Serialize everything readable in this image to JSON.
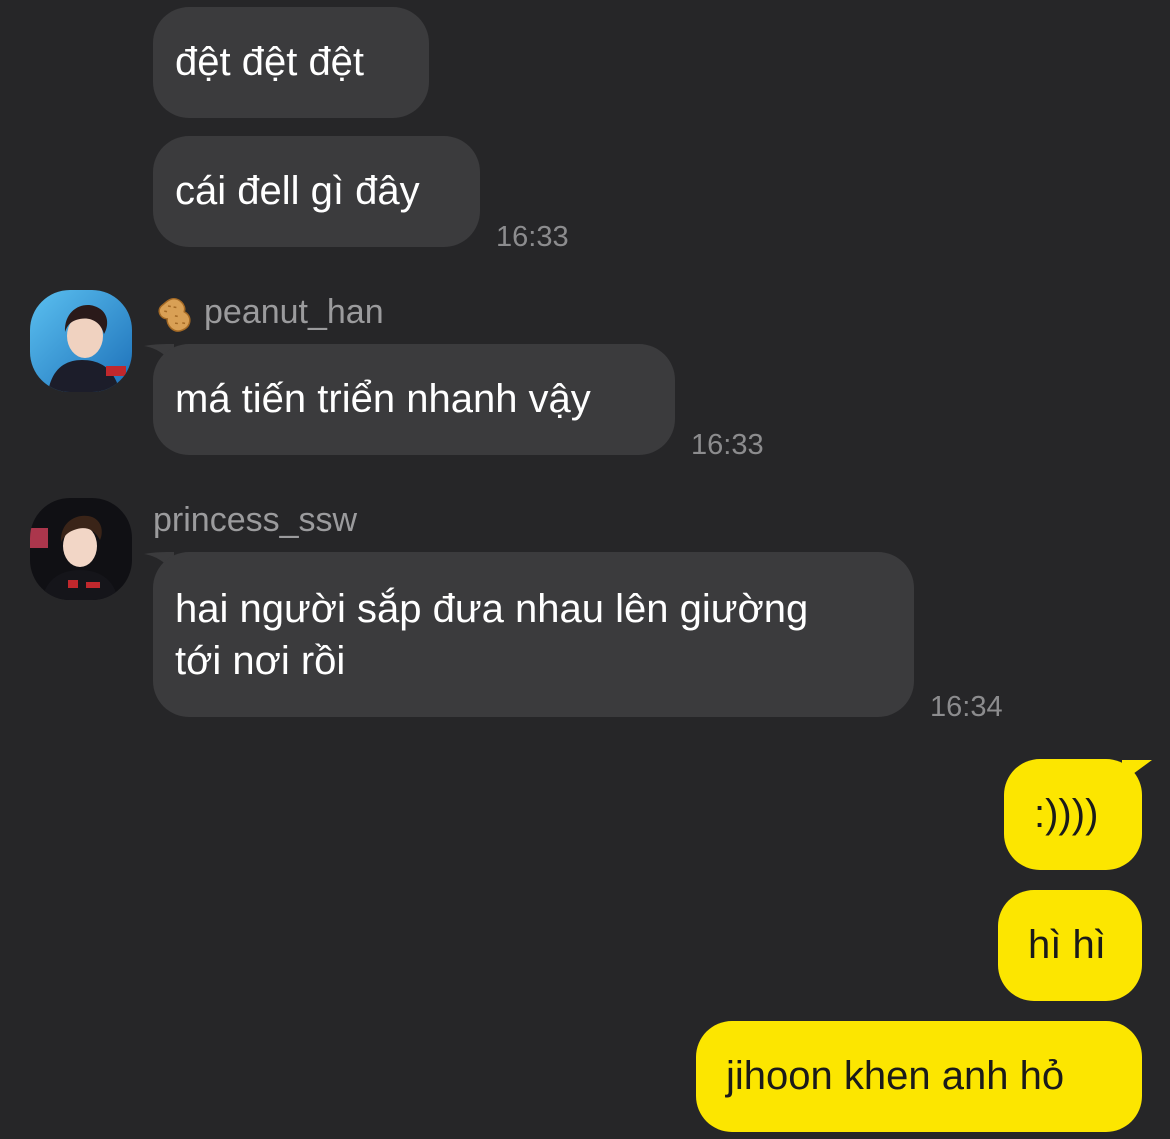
{
  "messages": [
    {
      "direction": "incoming",
      "text": "đệt đệt đệt"
    },
    {
      "direction": "incoming",
      "text": "cái đell gì đây",
      "time": "16:33"
    },
    {
      "direction": "incoming",
      "sender": "peanut_han",
      "sender_badge_icon": "peanut-icon",
      "text": "má tiến triển nhanh vậy",
      "time": "16:33"
    },
    {
      "direction": "incoming",
      "sender": "princess_ssw",
      "text": "hai người sắp đưa nhau lên giường\ntới nơi rồi",
      "time": "16:34"
    },
    {
      "direction": "outgoing",
      "text": ":))))"
    },
    {
      "direction": "outgoing",
      "text": "hì hì"
    },
    {
      "direction": "outgoing",
      "text": "jihoon khen anh hỏ"
    }
  ],
  "colors": {
    "background": "#262628",
    "incoming_bubble": "#3b3b3d",
    "outgoing_bubble": "#fce600",
    "timestamp": "#8c8c8e",
    "sender_name": "#9b9b9d"
  }
}
